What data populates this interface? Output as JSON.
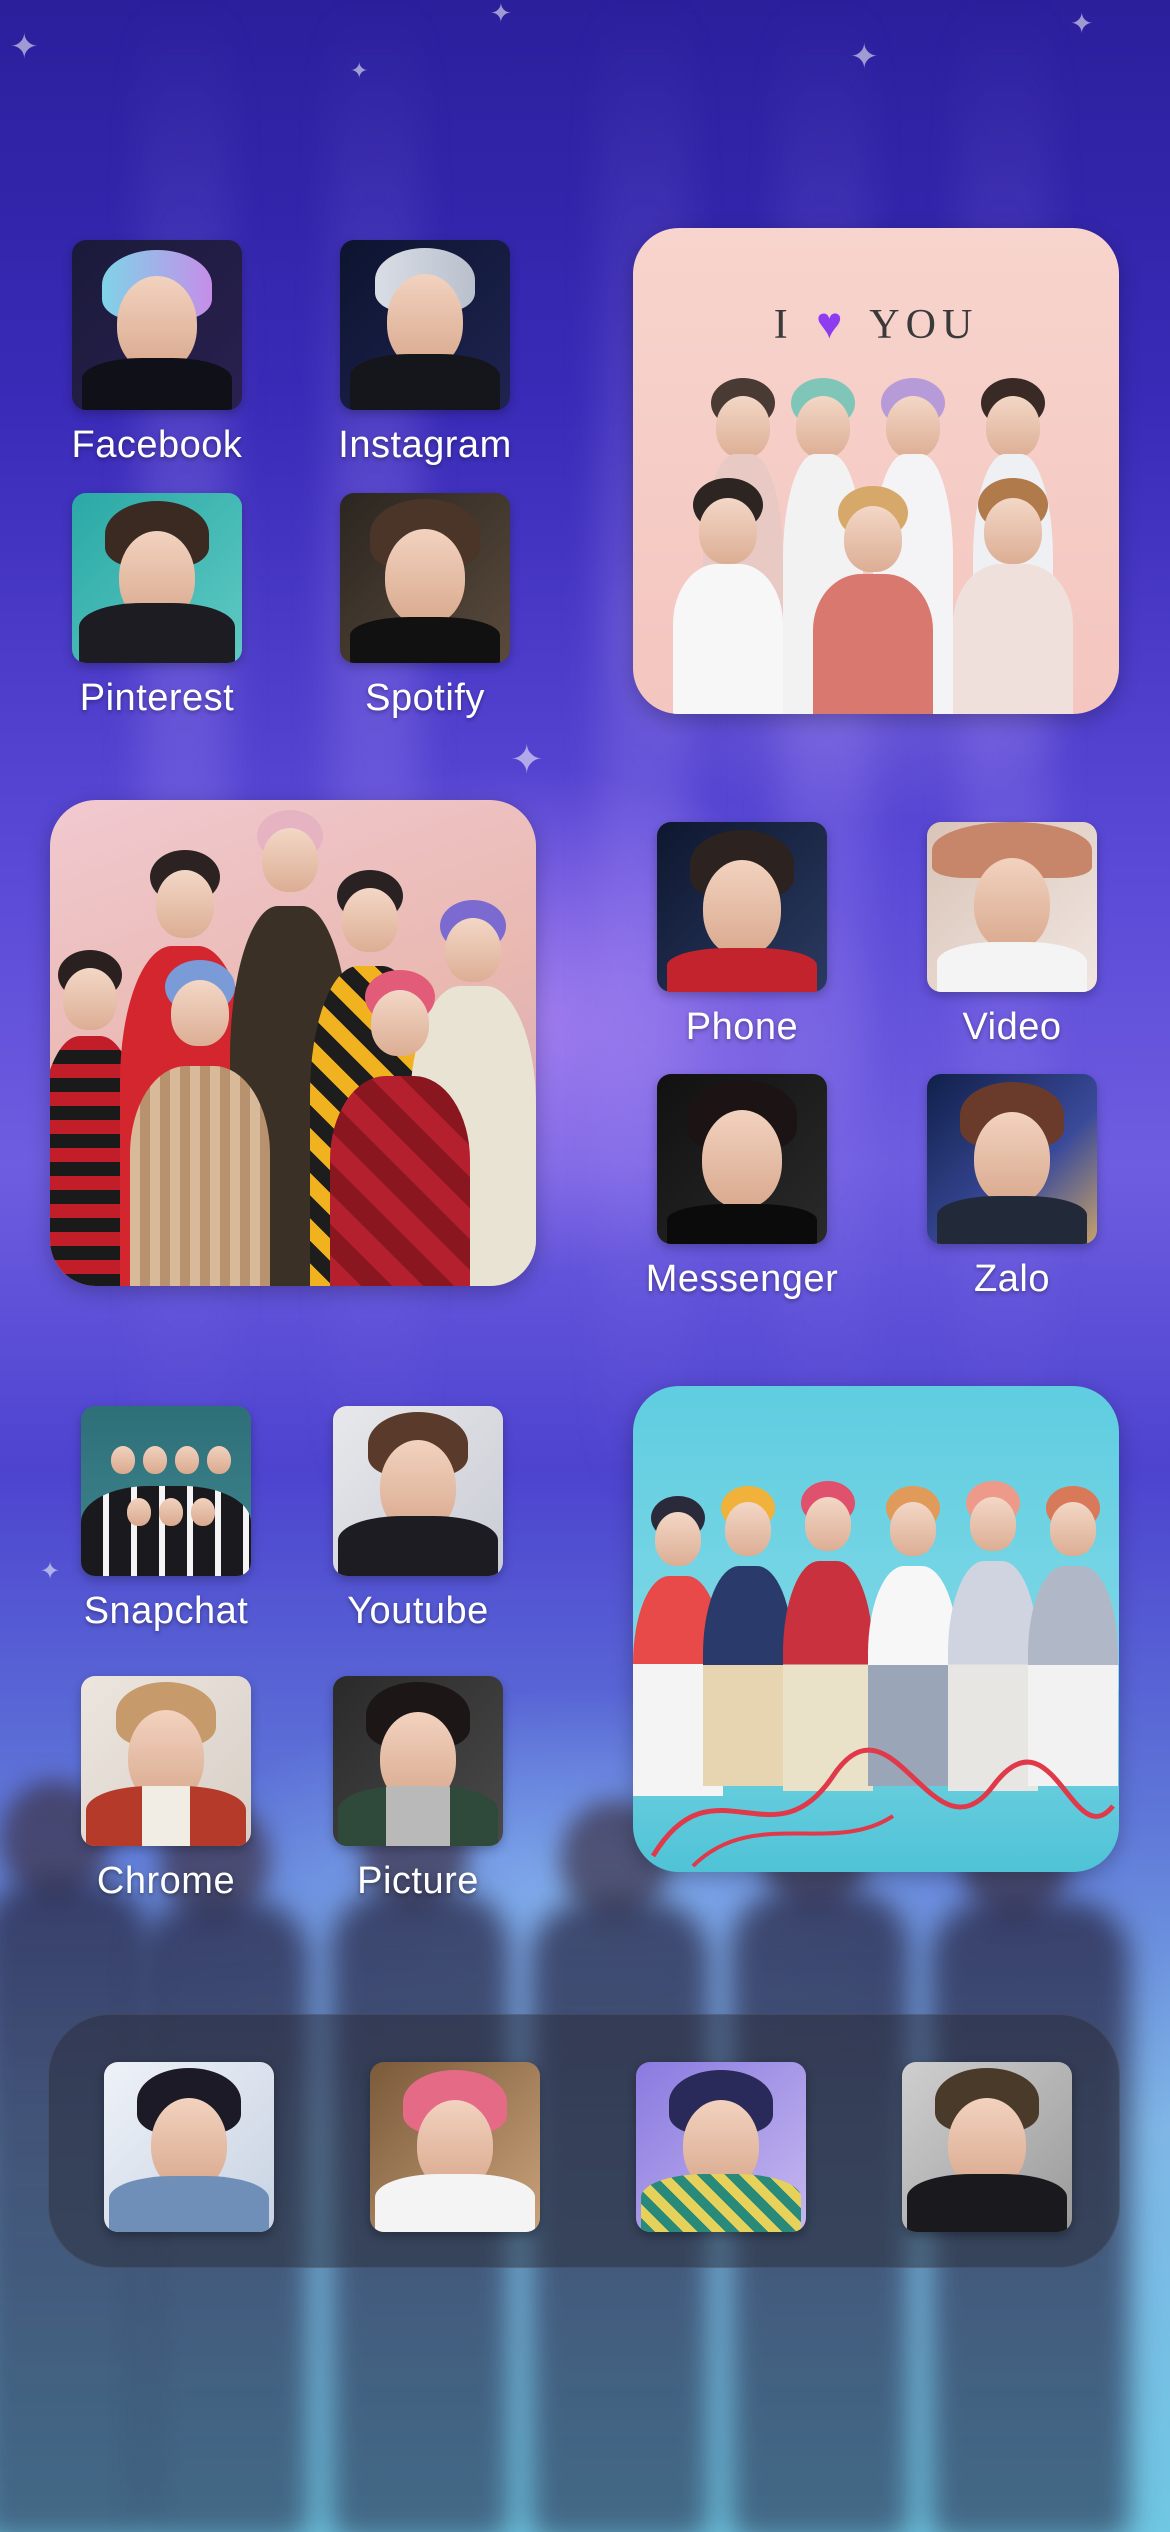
{
  "home_screen": {
    "apps_group_1": [
      {
        "label": "Facebook"
      },
      {
        "label": "Instagram"
      },
      {
        "label": "Pinterest"
      },
      {
        "label": "Spotify"
      }
    ],
    "apps_group_2": [
      {
        "label": "Phone"
      },
      {
        "label": "Video"
      },
      {
        "label": "Messenger"
      },
      {
        "label": "Zalo"
      }
    ],
    "apps_group_3": [
      {
        "label": "Snapchat"
      },
      {
        "label": "Youtube"
      },
      {
        "label": "Chrome"
      },
      {
        "label": "Picture"
      }
    ],
    "widgets": {
      "top_right_caption_left": "I",
      "top_right_caption_heart": "♥",
      "top_right_caption_right": "YOU"
    }
  },
  "dock": {
    "icon_count": 4
  },
  "colors": {
    "background_top": "#2b1f9c",
    "background_mid": "#6e5de0",
    "background_bottom": "#6fc7e3",
    "heart": "#8e3cf0",
    "label_text": "#ffffff"
  }
}
